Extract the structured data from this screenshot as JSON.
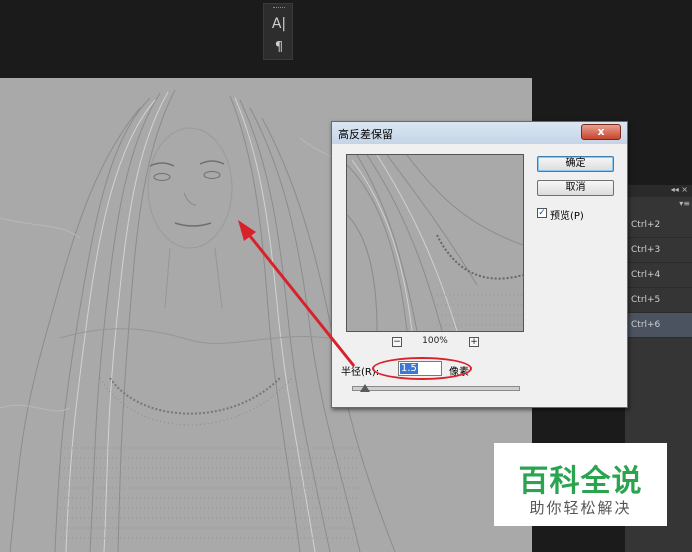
{
  "tools": {
    "character": "A|",
    "paragraph": "¶"
  },
  "panel": {
    "header_icons": "◂◂ ×",
    "menu": "▾≡",
    "shortcuts": [
      {
        "label": "Ctrl+2",
        "selected": false
      },
      {
        "label": "Ctrl+3",
        "selected": false
      },
      {
        "label": "Ctrl+4",
        "selected": false
      },
      {
        "label": "Ctrl+5",
        "selected": false
      },
      {
        "label": "Ctrl+6",
        "selected": true
      }
    ]
  },
  "dialog": {
    "title": "高反差保留",
    "close_label": "x",
    "zoom_out": "−",
    "zoom_level": "100%",
    "zoom_in": "+",
    "ok_label": "确定",
    "cancel_label": "取消",
    "preview_checked": true,
    "preview_check_mark": "✓",
    "preview_label": "预览(P)",
    "radius_label": "半径(R):",
    "radius_value": "1.5",
    "radius_unit": "像素",
    "slider_fraction": 0.05
  },
  "watermark": {
    "title": "百科全说",
    "subtitle": "助你轻松解决"
  },
  "colors": {
    "canvas": "#a9a9a9",
    "annotation": "#d8222b",
    "watermark_green": "#2aa44f"
  }
}
